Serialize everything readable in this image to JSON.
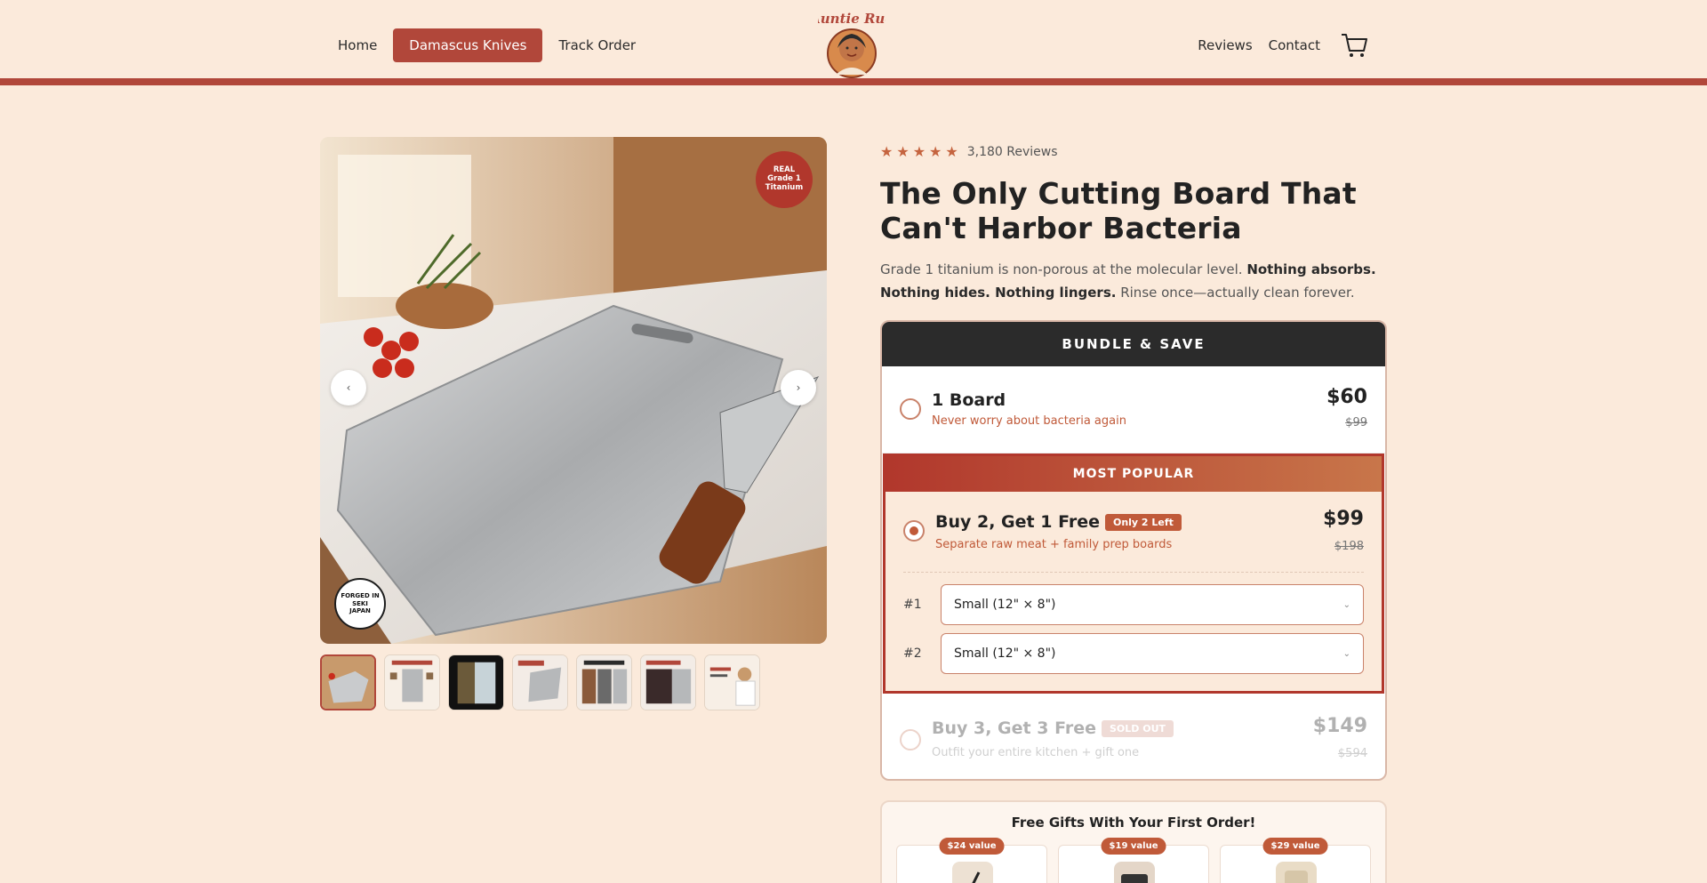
{
  "nav": {
    "left": [
      "Home",
      "Damascus Knives",
      "Track Order"
    ],
    "right": [
      "Reviews",
      "Contact"
    ],
    "cart_icon": "cart-icon"
  },
  "brand": {
    "logo_text": "Auntie Rue"
  },
  "gallery": {
    "badge_top": [
      "REAL",
      "Grade 1",
      "Titanium"
    ],
    "badge_bottom": [
      "FORGED IN",
      "SEKI",
      "JAPAN"
    ],
    "prev_label": "‹",
    "next_label": "›",
    "thumb_count": 7,
    "active_thumb": 0
  },
  "product": {
    "rating": 5,
    "reviews": "3,180 Reviews",
    "title": "The Only Cutting Board That Can't Harbor Bacteria",
    "desc_plain_1": "Grade 1 titanium is non-porous at the molecular level. ",
    "desc_bold_1": "Nothing absorbs. Nothing hides. Nothing lingers.",
    "desc_plain_2": " Rinse once—actually clean forever."
  },
  "bundle": {
    "heading": "BUNDLE & SAVE",
    "options": [
      {
        "name": "1 Board",
        "sub": "Never worry about bacteria again",
        "price": "$60",
        "old": "$99"
      },
      {
        "header": "MOST POPULAR",
        "name": "Buy 2, Get 1 Free",
        "tag": "Only 2 Left",
        "sub": "Separate raw meat + family prep boards",
        "price": "$99",
        "old": "$198"
      },
      {
        "name": "Buy 3, Get 3 Free",
        "tag": "SOLD OUT",
        "sub": "Outfit your entire kitchen + gift one",
        "price": "$149",
        "old": "$594"
      }
    ],
    "selects": [
      {
        "label": "#1",
        "value": "Small (12\" × 8\")"
      },
      {
        "label": "#2",
        "value": "Small (12\" × 8\")"
      }
    ]
  },
  "gifts": {
    "title": "Free Gifts With Your First Order!",
    "items": [
      {
        "value": "$24 value"
      },
      {
        "value": "$19 value"
      },
      {
        "value": "$29 value"
      }
    ]
  },
  "colors": {
    "accent": "#b1473a",
    "background": "#fbeadb",
    "dark": "#2b2b2b"
  }
}
